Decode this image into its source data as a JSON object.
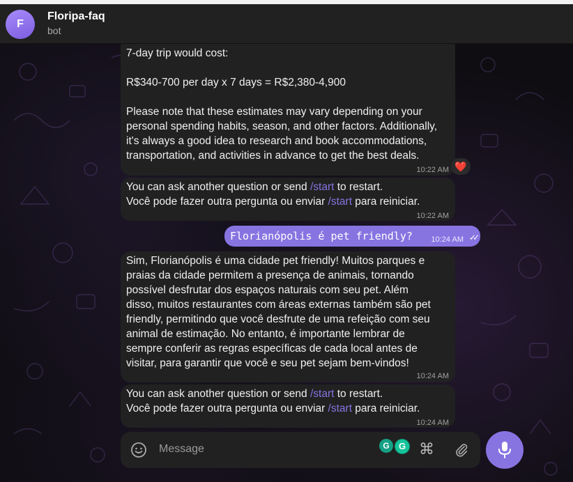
{
  "header": {
    "avatar_letter": "F",
    "title": "Floripa-faq",
    "subtitle": "bot"
  },
  "messages": {
    "m1": {
      "lines": [
        "7-day trip would cost:",
        "",
        "R$340-700 per day x 7 days = R$2,380-4,900",
        "",
        "Please note that these estimates may vary depending on your",
        "personal spending habits, season, and other factors. Additionally,",
        "it's always a good idea to research and book accommodations,",
        "transportation, and activities in advance to get the best deals."
      ],
      "time": "10:22 AM",
      "reaction": "❤️"
    },
    "m2": {
      "line1_pre": "You can ask another question or send ",
      "line1_link": "/start",
      "line1_post": " to restart.",
      "line2_pre": "Você pode fazer outra pergunta ou enviar ",
      "line2_link": "/start",
      "line2_post": " para reiniciar.",
      "time": "10:22 AM"
    },
    "m3": {
      "text": "Florianópolis é pet friendly?",
      "time": "10:24 AM",
      "ticks": "✓✓"
    },
    "m4": {
      "lines": [
        "Sim, Florianópolis é uma cidade pet friendly! Muitos parques e",
        "praias da cidade permitem a presença de animais, tornando",
        "possível desfrutar dos espaços naturais com seu pet. Além",
        "disso, muitos restaurantes com áreas externas também são pet",
        "friendly, permitindo que você desfrute de uma refeição com seu",
        "animal de estimação. No entanto, é importante lembrar de",
        "sempre conferir as regras específicas de cada local antes de",
        "visitar, para garantir que você e seu pet sejam bem-vindos!"
      ],
      "time": "10:24 AM"
    },
    "m5": {
      "line1_pre": "You can ask another question or send ",
      "line1_link": "/start",
      "line1_post": " to restart.",
      "line2_pre": "Você pode fazer outra pergunta ou enviar ",
      "line2_link": "/start",
      "line2_post": " para reiniciar.",
      "time": "10:24 AM"
    }
  },
  "composer": {
    "placeholder": "Message",
    "grammarly_left": "G",
    "grammarly_right": "G",
    "command_glyph": "⌘"
  },
  "icons": {
    "emoji": "smile-icon",
    "attach": "paperclip-icon",
    "mic": "microphone-icon"
  },
  "colors": {
    "accent": "#8774e1",
    "bubble": "#212121",
    "link": "#8774e1"
  }
}
